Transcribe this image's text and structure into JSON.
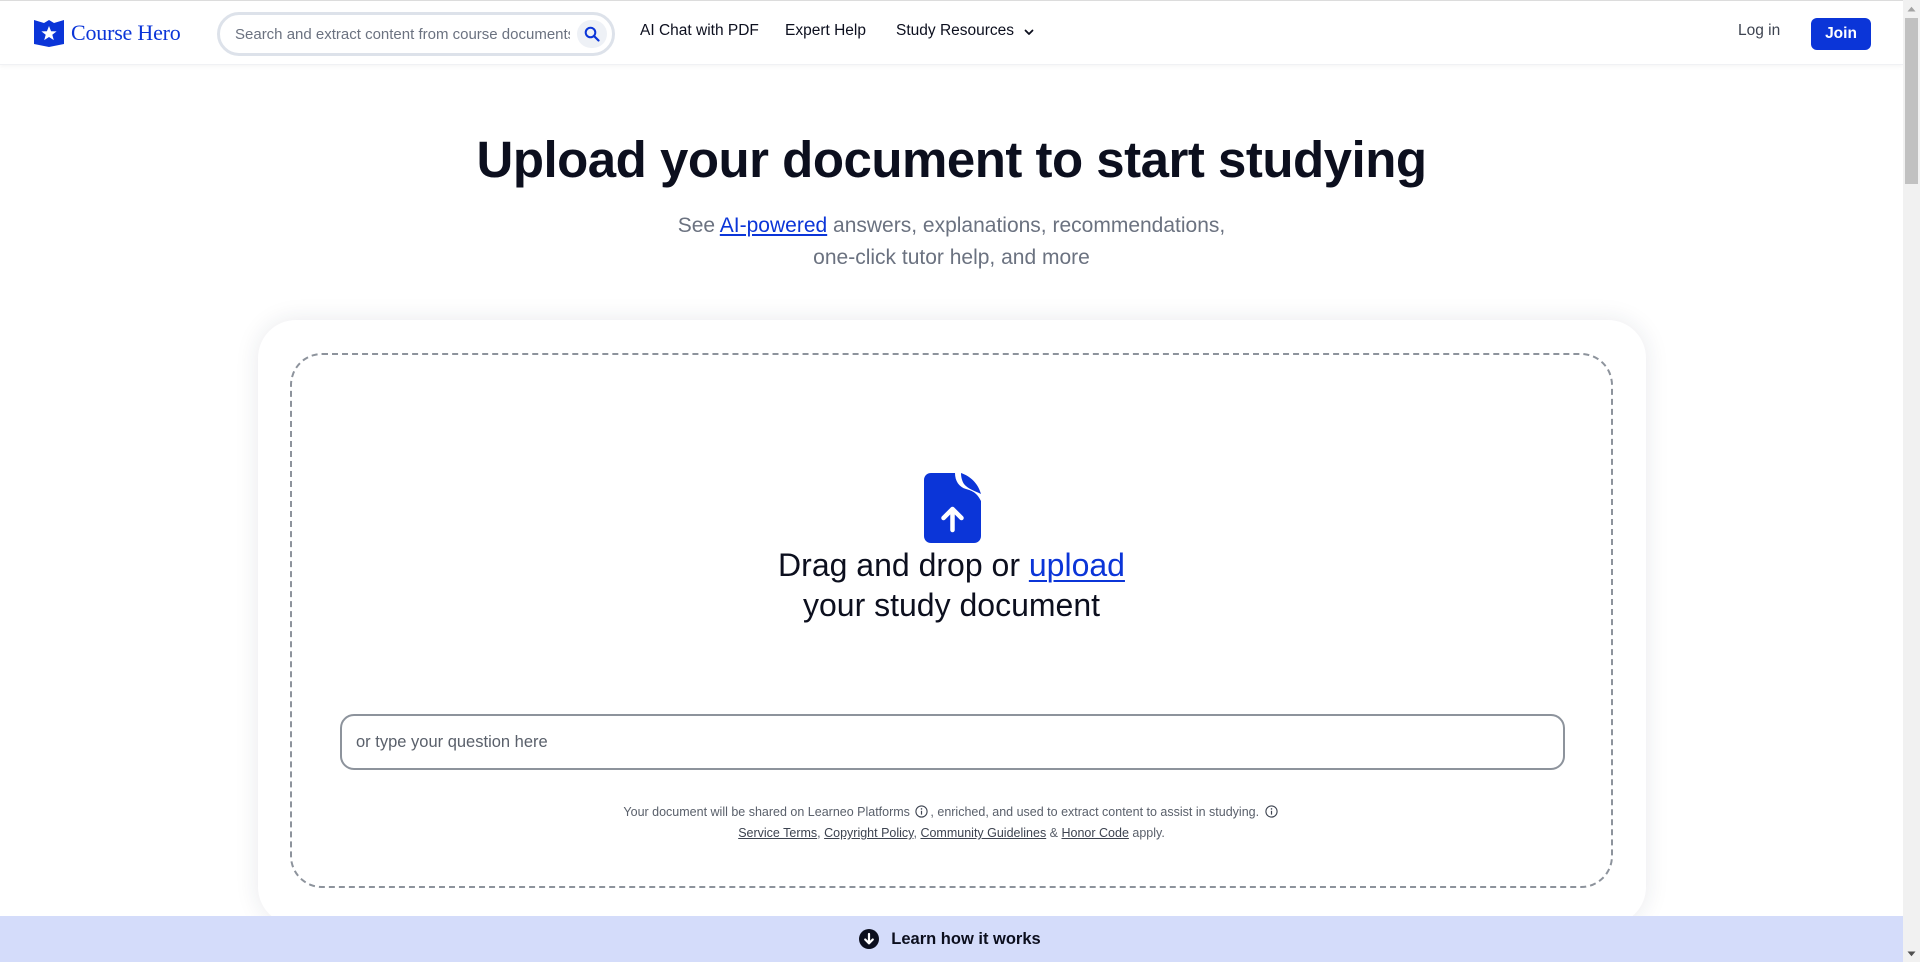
{
  "header": {
    "logo_text": "Course Hero",
    "search_placeholder": "Search and extract content from course documents, study guides and more",
    "nav": {
      "ai_chat": "AI Chat with PDF",
      "expert_help": "Expert Help",
      "study_resources": "Study Resources"
    },
    "login": "Log in",
    "join": "Join"
  },
  "hero": {
    "title": "Upload your document to start studying",
    "subtitle_prefix": "See ",
    "subtitle_link": "AI-powered",
    "subtitle_line1_rest": " answers, explanations, recommendations,",
    "subtitle_line2": "one-click tutor help, and more"
  },
  "upload": {
    "drag_prefix": "Drag and drop or ",
    "upload_link": "upload",
    "drag_line2": "your study document",
    "question_placeholder": "or type your question here",
    "legal_part1": "Your document will be shared on Learneo Platforms",
    "legal_part2": ", enriched, and used to extract content to assist in studying.",
    "links": {
      "service_terms": "Service Terms",
      "copyright_policy": "Copyright Policy",
      "community_guidelines": "Community Guidelines",
      "honor_code": "Honor Code"
    },
    "sep_comma": ", ",
    "sep_amp": " & ",
    "apply": " apply."
  },
  "learn": {
    "label": "Learn how it works"
  },
  "colors": {
    "brand": "#0b35d8",
    "learn_bar": "#d4dcfa",
    "text": "#0c0f1e",
    "muted": "#6b7280"
  }
}
